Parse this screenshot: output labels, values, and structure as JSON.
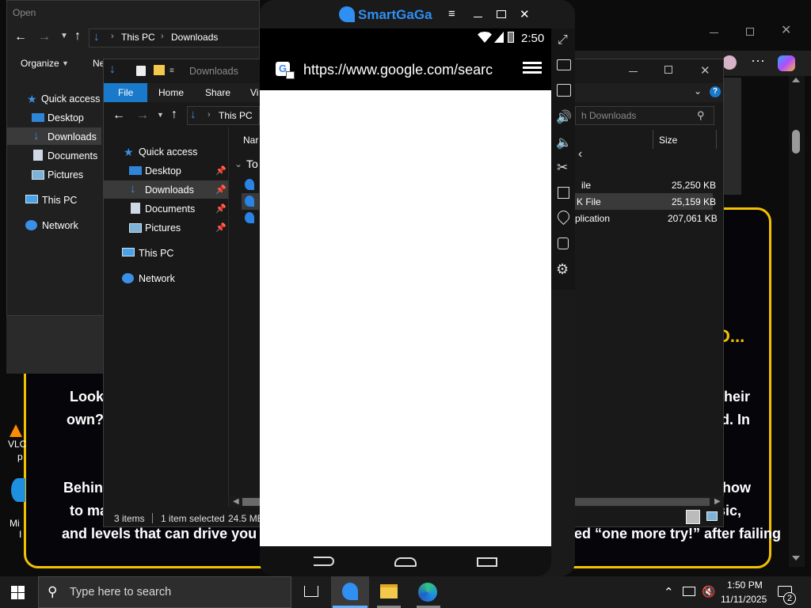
{
  "background_page": {
    "paragraph_1": [
      "Looki",
      "heir",
      "own?",
      "d. In"
    ],
    "paragraph_2": [
      "Behind",
      "how",
      "to ma",
      "sic,",
      "and levels that can drive you ma",
      "outed “one more try!” after failing"
    ],
    "ellipsis_heading": "D..."
  },
  "desktop_icons": [
    "VLC",
    "p",
    "Mi",
    "I"
  ],
  "open_dialog": {
    "title": "Open",
    "breadcrumb": [
      "This PC",
      "Downloads"
    ],
    "toolbar": [
      "Organize",
      "Ne"
    ],
    "nav": [
      "Quick access",
      "Desktop",
      "Downloads",
      "Documents",
      "Pictures",
      "This PC",
      "Network"
    ]
  },
  "explorer": {
    "title": "Downloads",
    "tabs": [
      "File",
      "Home",
      "Share",
      "Vi"
    ],
    "breadcrumb": [
      "This PC"
    ],
    "search_placeholder": "h Downloads",
    "nav": [
      "Quick access",
      "Desktop",
      "Downloads",
      "Documents",
      "Pictures",
      "This PC",
      "Network"
    ],
    "columns": {
      "name": "Nar",
      "size": "Size"
    },
    "group": "To",
    "rows": [
      {
        "type": "ile",
        "size": "25,250 KB"
      },
      {
        "type": "K File",
        "size": "25,159 KB"
      },
      {
        "type": "plication",
        "size": "207,061 KB"
      }
    ],
    "status": {
      "items": "3 items",
      "selected": "1 item selected",
      "size": "24.5 MB"
    }
  },
  "emulator": {
    "name": "SmartGaGa",
    "clock": "2:50",
    "url": "https://www.google.com/searc"
  },
  "taskbar": {
    "search_placeholder": "Type here to search",
    "time": "1:50 PM",
    "date": "11/11/2025",
    "notifications": "2"
  }
}
